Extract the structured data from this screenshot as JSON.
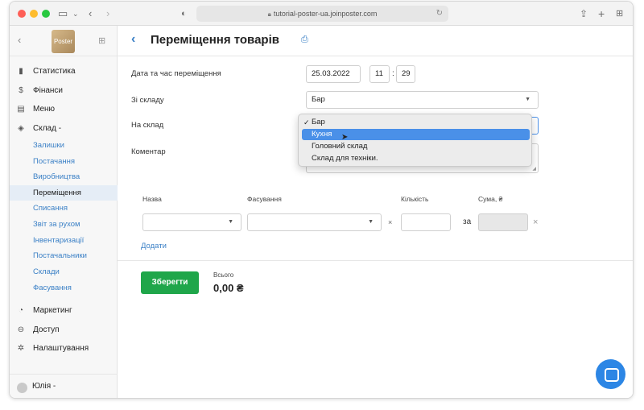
{
  "browser": {
    "url": "tutorial-poster-ua.joinposter.com"
  },
  "sidebar": {
    "logo_text": "Poster",
    "items": [
      {
        "icon": "chart-bars-icon",
        "label": "Статистика"
      },
      {
        "icon": "dollar-icon",
        "label": "Фінанси"
      },
      {
        "icon": "menu-book-icon",
        "label": "Меню"
      },
      {
        "icon": "layers-icon",
        "label": "Склад -"
      }
    ],
    "sub_items": [
      {
        "label": "Залишки"
      },
      {
        "label": "Постачання"
      },
      {
        "label": "Виробництва"
      },
      {
        "label": "Переміщення",
        "active": true
      },
      {
        "label": "Списання"
      },
      {
        "label": "Звіт за рухом"
      },
      {
        "label": "Інвентаризації"
      },
      {
        "label": "Постачальники"
      },
      {
        "label": "Склади"
      },
      {
        "label": "Фасування"
      }
    ],
    "bottom_items": [
      {
        "icon": "marketing-icon",
        "label": "Маркетинг"
      },
      {
        "icon": "lock-icon",
        "label": "Доступ"
      },
      {
        "icon": "gear-icon",
        "label": "Налаштування"
      }
    ],
    "user": "Юлія -"
  },
  "header": {
    "title": "Переміщення товарів"
  },
  "form": {
    "date_label": "Дата та час переміщення",
    "date_value": "25.03.2022",
    "hour_value": "11",
    "minute_value": "29",
    "time_sep": ":",
    "from_label": "Зі складу",
    "from_value": "Бар",
    "to_label": "На склад",
    "comment_label": "Коментар"
  },
  "dropdown": {
    "options": [
      {
        "label": "Бар",
        "checked": true
      },
      {
        "label": "Кухня",
        "highlighted": true
      },
      {
        "label": "Головний склад"
      },
      {
        "label": "Склад для техніки."
      }
    ]
  },
  "table": {
    "headers": {
      "name": "Назва",
      "packaging": "Фасування",
      "quantity": "Кількість",
      "sum": "Сума, ₴"
    },
    "times_sign": "×",
    "for_label": "за",
    "remove_sign": "×"
  },
  "add_link": "Додати",
  "save_button": "Зберегти",
  "total": {
    "label": "Всього",
    "value": "0,00 ₴"
  },
  "colors": {
    "accent": "#3b80c6",
    "save": "#1fa64a",
    "highlight": "#4a90e8",
    "chat": "#2c86e5"
  }
}
